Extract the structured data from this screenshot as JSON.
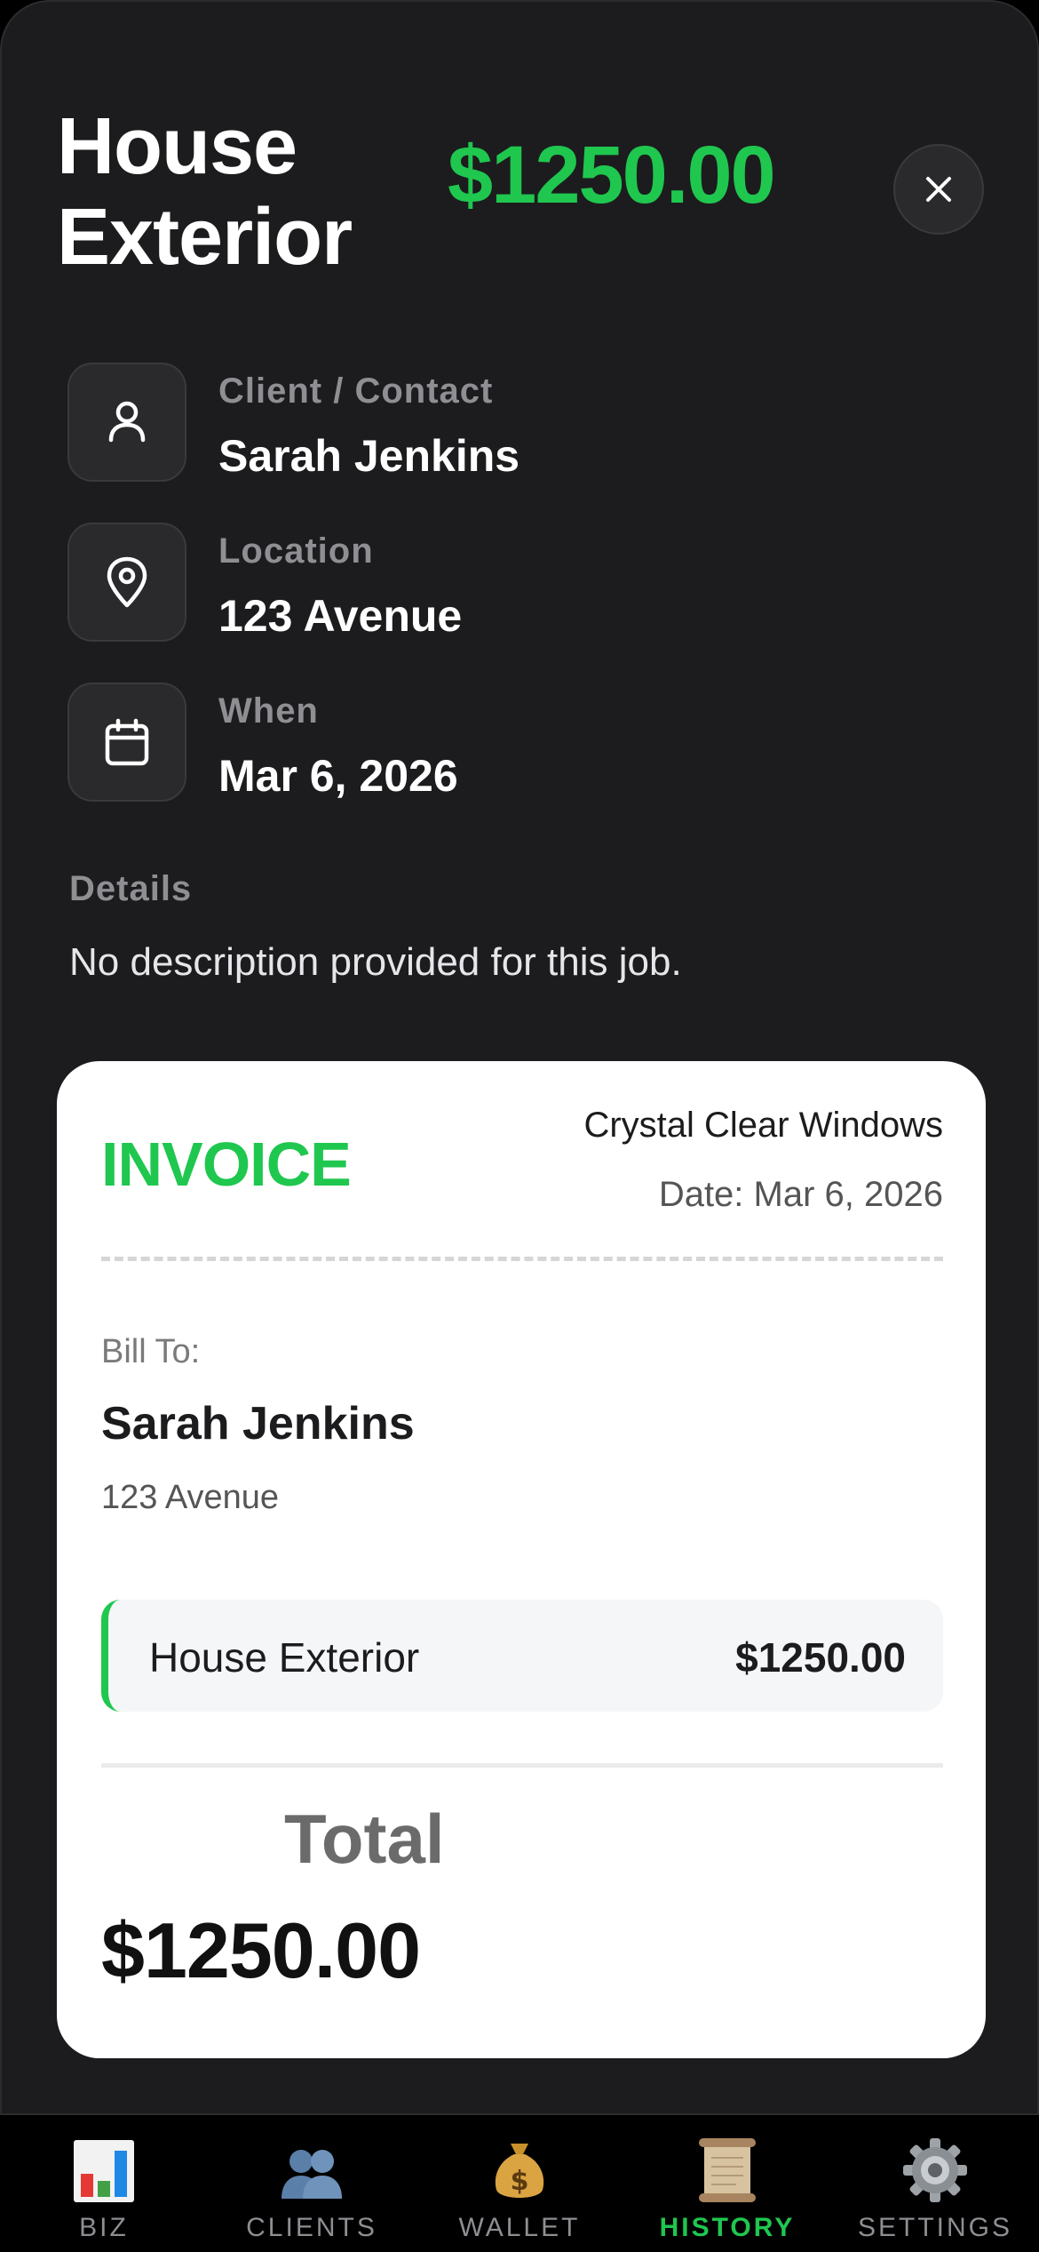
{
  "header": {
    "title": "House Exterior",
    "amount": "$1250.00"
  },
  "info": [
    {
      "label": "Client / Contact",
      "value": "Sarah Jenkins",
      "icon": "person-icon"
    },
    {
      "label": "Location",
      "value": "123 Avenue",
      "icon": "location-pin-icon"
    },
    {
      "label": "When",
      "value": "Mar 6, 2026",
      "icon": "calendar-icon"
    }
  ],
  "details": {
    "label": "Details",
    "text": "No description provided for this job."
  },
  "invoice": {
    "heading": "INVOICE",
    "company": "Crystal Clear Windows",
    "date": "Date: Mar 6, 2026",
    "bill_to_label": "Bill To:",
    "bill_to_name": "Sarah Jenkins",
    "bill_to_address": "123 Avenue",
    "line_items": [
      {
        "description": "House Exterior",
        "amount": "$1250.00"
      }
    ],
    "total_label": "Total",
    "total_amount": "$1250.00"
  },
  "tabs": [
    {
      "label": "BIZ",
      "icon": "bar-chart-icon"
    },
    {
      "label": "CLIENTS",
      "icon": "people-icon"
    },
    {
      "label": "WALLET",
      "icon": "money-bag-icon"
    },
    {
      "label": "HISTORY",
      "icon": "scroll-icon",
      "active": true
    },
    {
      "label": "SETTINGS",
      "icon": "gear-icon"
    }
  ],
  "colors": {
    "accent": "#1fc74f",
    "background": "#1c1c1e",
    "card": "#ffffff"
  }
}
